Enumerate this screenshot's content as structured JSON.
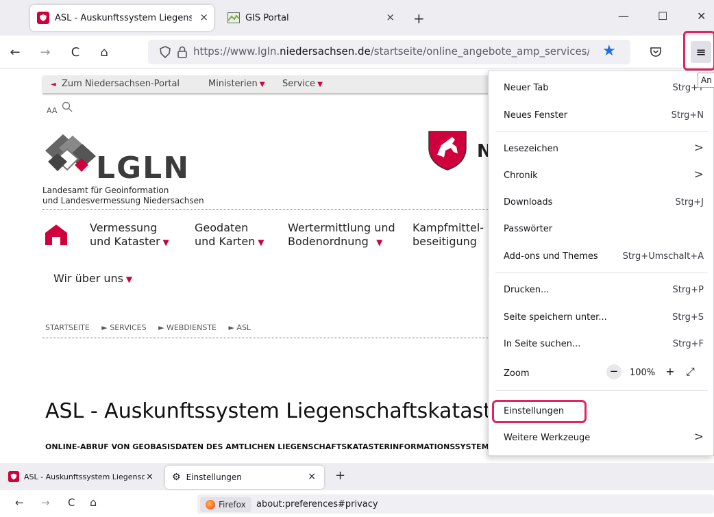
{
  "browser_top": {
    "tabs": [
      {
        "title": "ASL - Auskunftssystem Liegenschaftskataster",
        "close": "×"
      },
      {
        "title": "GIS Portal",
        "close": "×"
      }
    ],
    "new_tab": "+",
    "window_controls": {
      "minimize": "—",
      "maximize": "☐",
      "close": "✕"
    },
    "nav": {
      "back": "←",
      "forward": "→",
      "reload": "C",
      "home": "⌂"
    },
    "url": {
      "prefix": "https://www.lgln.",
      "domain": "niedersachsen.de",
      "path": "/startseite/online_angebote_amp_services/"
    },
    "menu_icon": "≡",
    "tooltip": "An"
  },
  "site": {
    "portal_link": "Zum Niedersachsen-Portal",
    "ministerien": "Ministerien",
    "service": "Service",
    "aa": "AA",
    "logo_text": "LGLN",
    "agency_line1": "Landesamt für Geoinformation",
    "agency_line2": "und Landesvermessung Niedersachsen",
    "state_initial": "N",
    "nav": [
      {
        "line1": "Vermessung",
        "line2": "und Kataster"
      },
      {
        "line1": "Geodaten",
        "line2": "und Karten"
      },
      {
        "line1": "Wertermittlung und",
        "line2": "Bodenordnung"
      },
      {
        "line1": "Kampfmittel-",
        "line2": "beseitigung"
      }
    ],
    "wir": "Wir über uns",
    "breadcrumb": [
      "STARTSEITE",
      "► SERVICES",
      "► WEBDIENSTE",
      "► ASL"
    ],
    "title": "ASL - Auskunftssystem Liegenschaftskataster",
    "subtitle": "ONLINE-ABRUF VON GEOBASISDATEN DES AMTLICHEN LIEGENSCHAFTSKATASTERINFORMATIONSSYSTEMS"
  },
  "menu": {
    "items": [
      {
        "label": "Neuer Tab",
        "shortcut": "Strg+T"
      },
      {
        "label": "Neues Fenster",
        "shortcut": "Strg+N"
      },
      {
        "label": "Lesezeichen",
        "shortcut": ">"
      },
      {
        "label": "Chronik",
        "shortcut": ">"
      },
      {
        "label": "Downloads",
        "shortcut": "Strg+J"
      },
      {
        "label": "Passwörter",
        "shortcut": ""
      },
      {
        "label": "Add-ons und Themes",
        "shortcut": "Strg+Umschalt+A"
      },
      {
        "label": "Drucken...",
        "shortcut": "Strg+P"
      },
      {
        "label": "Seite speichern unter...",
        "shortcut": "Strg+S"
      },
      {
        "label": "In Seite suchen...",
        "shortcut": "Strg+F"
      },
      {
        "label": "Zoom",
        "shortcut": ""
      },
      {
        "label": "Einstellungen",
        "shortcut": ""
      },
      {
        "label": "Weitere Werkzeuge",
        "shortcut": ">"
      }
    ],
    "zoom": {
      "minus": "−",
      "value": "100%",
      "plus": "+",
      "fullscreen": "⤢"
    }
  },
  "browser_bottom": {
    "tabs": [
      {
        "title": "ASL - Auskunftssystem Liegenschaftskataster",
        "close": "×"
      },
      {
        "title": "Einstellungen",
        "close": "×"
      }
    ],
    "new_tab": "+",
    "nav": {
      "back": "←",
      "forward": "→",
      "reload": "C",
      "home": "⌂"
    },
    "identity": "Firefox",
    "url": "about:preferences#privacy"
  }
}
